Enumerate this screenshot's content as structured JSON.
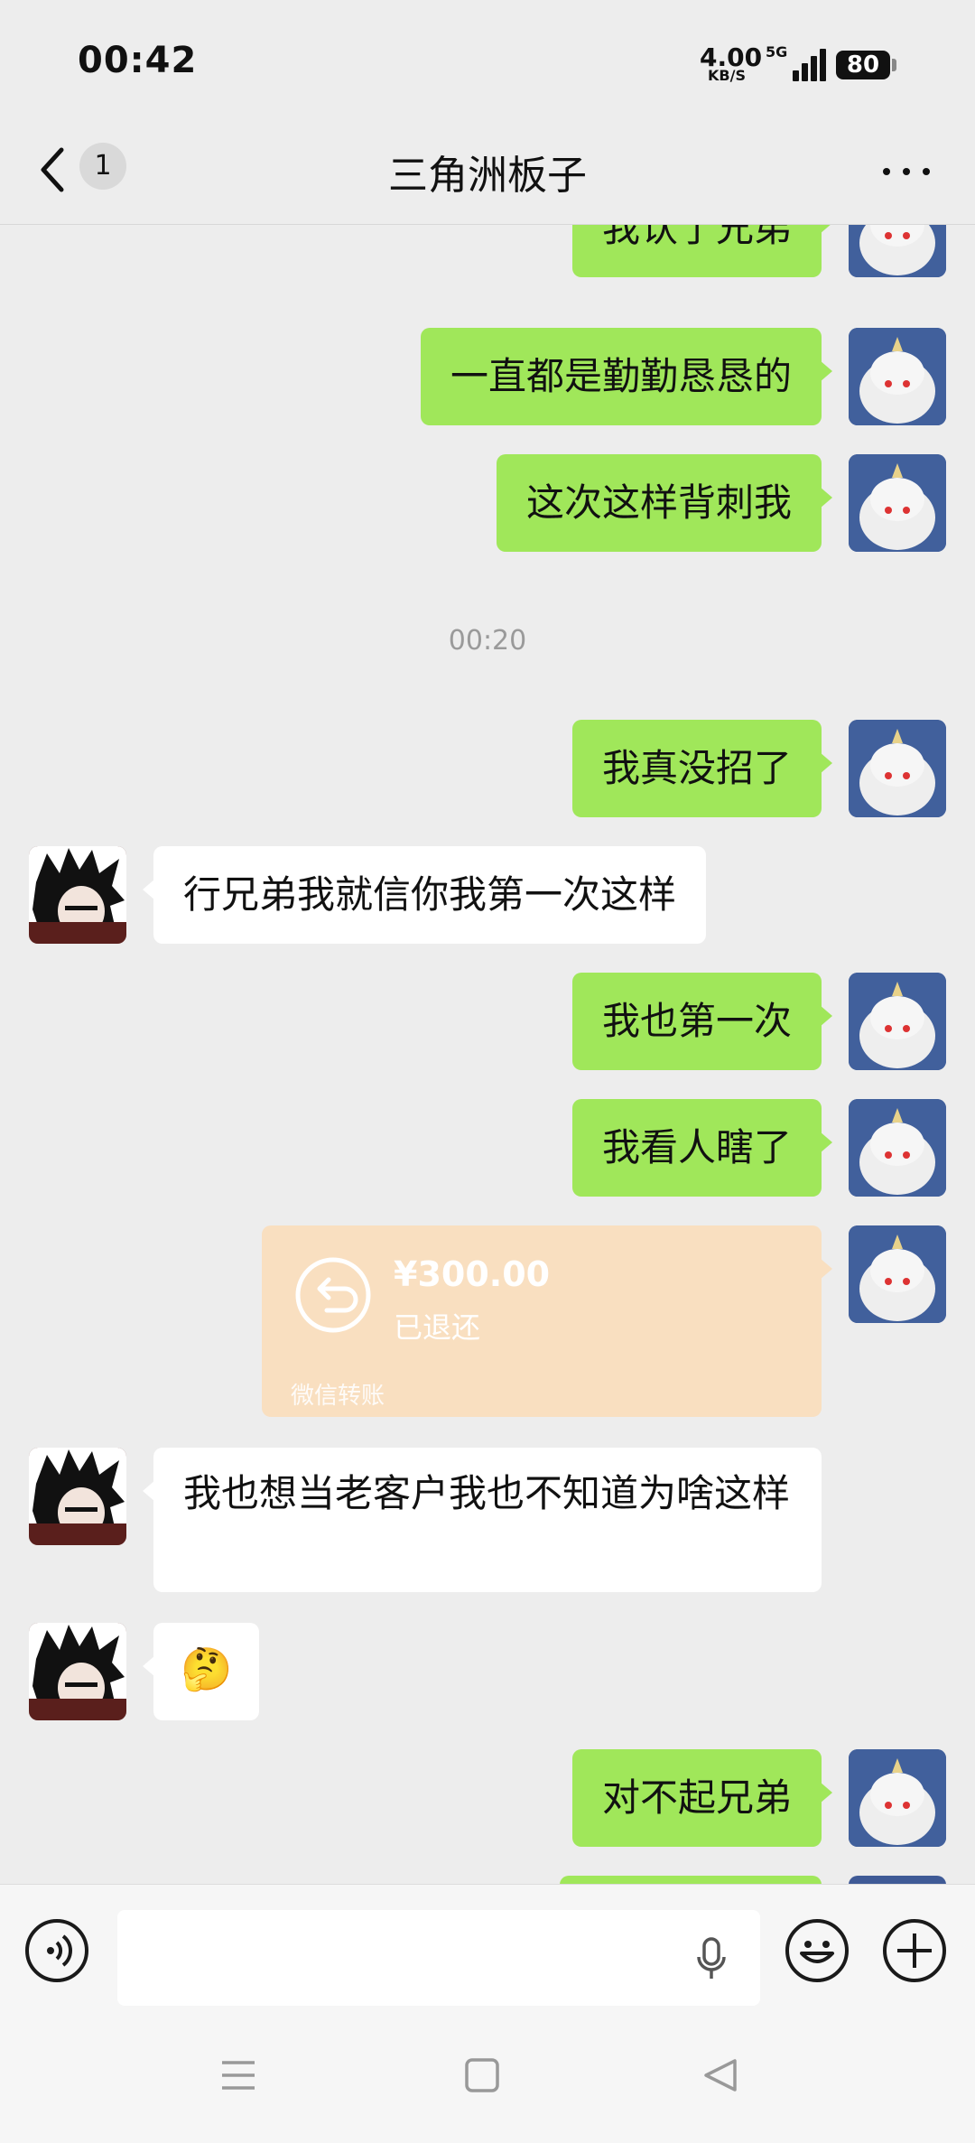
{
  "status_bar": {
    "time": "00:42",
    "net_speed": "4.00",
    "net_unit": "KB/S",
    "network": "5G",
    "battery": "80"
  },
  "header": {
    "back_icon": "chevron-left-icon",
    "unread_count": "1",
    "title": "三角洲板子",
    "more_icon": "more-dots-icon"
  },
  "messages": [
    {
      "side": "out",
      "text": "我认了兄弟"
    },
    {
      "side": "out",
      "text": "一直都是勤勤恳恳的"
    },
    {
      "side": "out",
      "text": "这次这样背刺我"
    },
    {
      "timestamp": "00:20"
    },
    {
      "side": "out",
      "text": "我真没招了"
    },
    {
      "side": "in",
      "text": "行兄弟我就信你我第一次这样"
    },
    {
      "side": "out",
      "text": "我也第一次"
    },
    {
      "side": "out",
      "text": "我看人瞎了"
    },
    {
      "side": "out",
      "type": "transfer",
      "amount": "¥300.00",
      "status": "已退还",
      "label": "微信转账"
    },
    {
      "side": "in",
      "text": "我也想当老客户我也不知道为啥这样"
    },
    {
      "side": "in",
      "text": "🤔"
    },
    {
      "side": "out",
      "text": "对不起兄弟"
    }
  ],
  "input_bar": {
    "voice_icon": "voice-input-icon",
    "mic_icon": "microphone-icon",
    "emoji_icon": "emoji-icon",
    "plus_icon": "plus-icon"
  },
  "system_nav": {
    "menu_icon": "menu-icon",
    "home_icon": "home-icon",
    "back_icon": "back-triangle-icon"
  },
  "colors": {
    "outgoing_bubble": "#a0e75a",
    "incoming_bubble": "#ffffff",
    "transfer_card": "#f9dfc0",
    "chat_background": "#ededed"
  }
}
